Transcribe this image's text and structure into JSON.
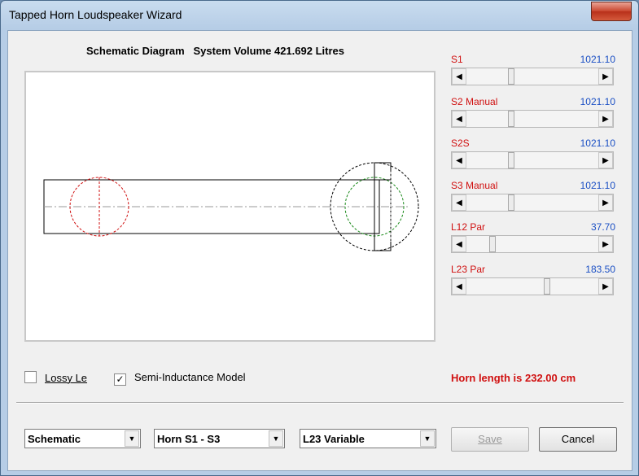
{
  "window": {
    "title": "Tapped Horn Loudspeaker Wizard",
    "close_glyph": "✕"
  },
  "caption": "Schematic Diagram   System Volume 421.692 Litres",
  "params": [
    {
      "label": "S1",
      "value": "1021.10"
    },
    {
      "label": "S2 Manual",
      "value": "1021.10"
    },
    {
      "label": "S2S",
      "value": "1021.10"
    },
    {
      "label": "S3 Manual",
      "value": "1021.10"
    },
    {
      "label": "L12 Par",
      "value": "37.70"
    },
    {
      "label": "L23 Par",
      "value": "183.50"
    }
  ],
  "scroll_levels": [
    0.33,
    0.33,
    0.33,
    0.33,
    0.18,
    0.61
  ],
  "options": {
    "lossy_le": {
      "label": "Lossy Le",
      "checked": false
    },
    "semi_inductance": {
      "label": "Semi-Inductance Model",
      "checked": true
    }
  },
  "horn_length": "Horn length is 232.00 cm",
  "combos": [
    {
      "value": "Schematic"
    },
    {
      "value": "Horn S1 - S3"
    },
    {
      "value": "L23 Variable"
    }
  ],
  "buttons": {
    "save": "Save",
    "cancel": "Cancel"
  },
  "icons": {
    "arrow_left": "◀",
    "arrow_right": "▶",
    "dropdown": "▼",
    "check": "✓"
  },
  "colors": {
    "label": "#d01010",
    "value": "#1a4fc4",
    "driver_circle": "#d01010",
    "port_circle": "#1a8a1a"
  }
}
